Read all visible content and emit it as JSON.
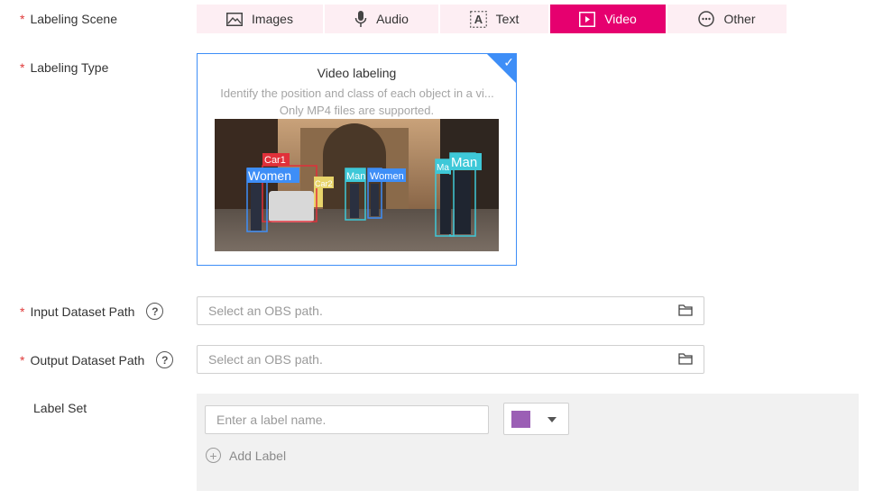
{
  "labels": {
    "scene": "Labeling Scene",
    "type": "Labeling Type",
    "input_path": "Input Dataset Path",
    "output_path": "Output Dataset Path",
    "label_set": "Label Set",
    "required_mark": "*",
    "help_mark": "?"
  },
  "scene_tabs": [
    {
      "label": "Images",
      "icon": "image-icon",
      "active": false
    },
    {
      "label": "Audio",
      "icon": "microphone-icon",
      "active": false
    },
    {
      "label": "Text",
      "icon": "text-icon",
      "active": false
    },
    {
      "label": "Video",
      "icon": "video-play-icon",
      "active": true
    },
    {
      "label": "Other",
      "icon": "more-circle-icon",
      "active": false
    }
  ],
  "type_card": {
    "title": "Video labeling",
    "description": "Identify the position and class of each object in a vi...",
    "sub": "Only MP4 files are supported.",
    "selected": true,
    "boxes": [
      {
        "label": "Car1"
      },
      {
        "label": "Women"
      },
      {
        "label": "Car2"
      },
      {
        "label": "Man"
      },
      {
        "label": "Women"
      },
      {
        "label": "Ma"
      },
      {
        "label": "Man"
      }
    ]
  },
  "input_path": {
    "placeholder": "Select an OBS path."
  },
  "output_path": {
    "placeholder": "Select an OBS path."
  },
  "label_set": {
    "name_placeholder": "Enter a label name.",
    "color": "#9b5fb5",
    "add_label": "Add Label"
  },
  "colors": {
    "accent": "#e6006f",
    "tab_bg": "#fdeef3",
    "card_border": "#3e8ef7"
  }
}
